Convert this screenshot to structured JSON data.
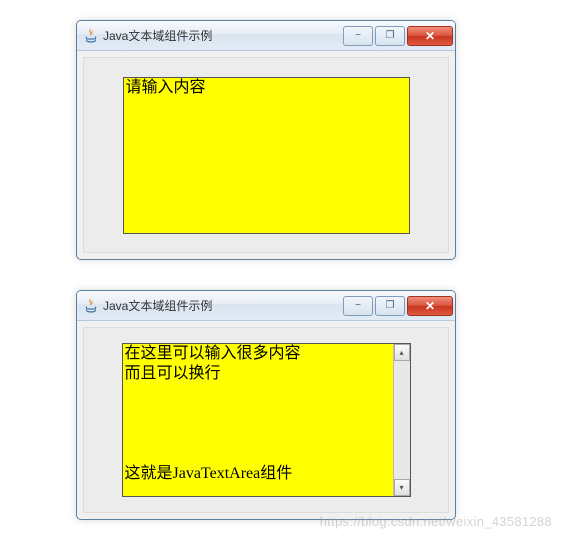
{
  "windows": [
    {
      "title": "Java文本域组件示例",
      "textarea_content": "请输入内容",
      "has_scrollbar": false
    },
    {
      "title": "Java文本域组件示例",
      "textarea_content": "在这里可以输入很多内容\n而且可以换行\n\n\n\n\n这就是JavaTextArea组件",
      "has_scrollbar": true
    }
  ],
  "icons": {
    "java": "java-icon",
    "minimize": "−",
    "maximize": "❐",
    "close": "✕",
    "scroll_up": "▴",
    "scroll_down": "▾"
  },
  "watermark": "https://blog.csdn.net/weixin_43581288"
}
